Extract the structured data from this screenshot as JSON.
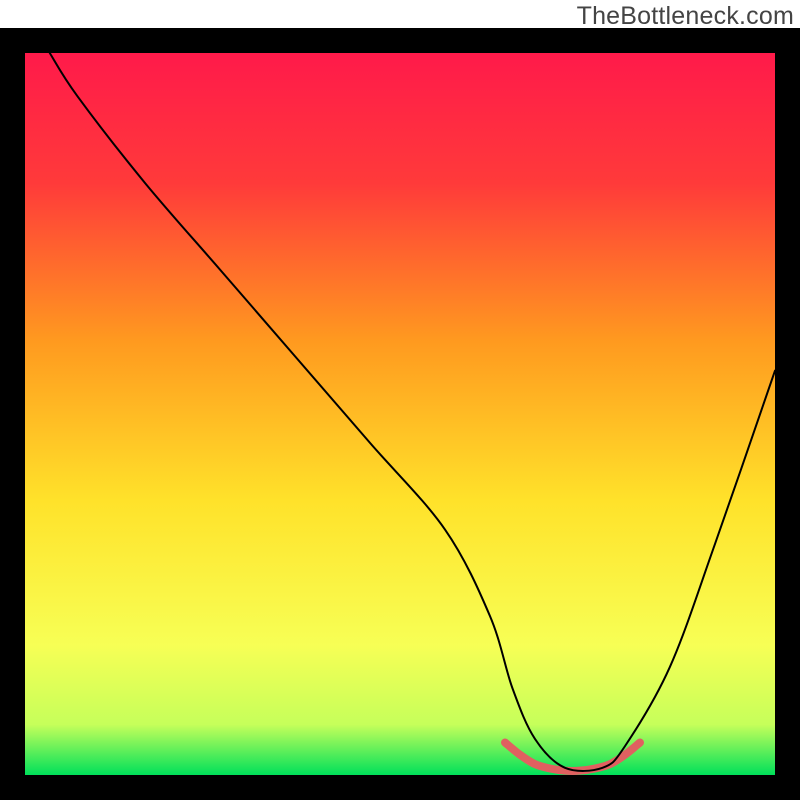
{
  "watermark": "TheBottleneck.com",
  "chart_data": {
    "type": "line",
    "title": "",
    "xlabel": "",
    "ylabel": "",
    "xlim": [
      0,
      100
    ],
    "ylim": [
      0,
      100
    ],
    "background_gradient": {
      "top": "#ff1a4a",
      "mid": "#fff200",
      "bottom": "#00e05a"
    },
    "frame_color": "#000000",
    "series": [
      {
        "name": "curve",
        "color": "#000000",
        "stroke_width": 2,
        "x": [
          3.3,
          7,
          16,
          26,
          36,
          46,
          56,
          62,
          65,
          68,
          72,
          77,
          80,
          86,
          92,
          100
        ],
        "values": [
          100,
          94,
          82,
          70,
          58,
          46,
          34,
          22,
          12,
          5,
          1,
          1,
          4,
          15,
          32,
          56
        ]
      },
      {
        "name": "highlight-band",
        "color": "#e06060",
        "stroke_width": 8,
        "x": [
          64,
          66,
          68,
          70,
          72,
          74,
          76,
          78,
          80,
          82
        ],
        "values": [
          4.5,
          2.8,
          1.5,
          0.9,
          0.6,
          0.6,
          0.9,
          1.5,
          2.8,
          4.5
        ]
      }
    ]
  }
}
